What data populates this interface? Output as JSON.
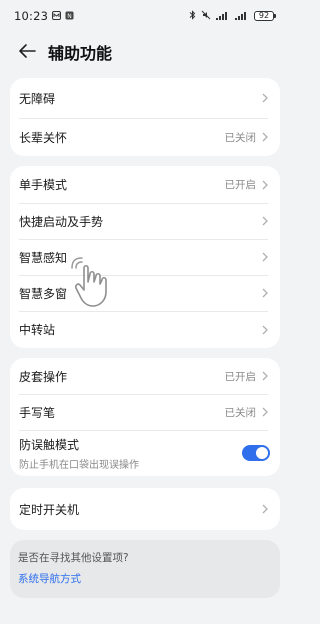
{
  "status_bar": {
    "time": "10:23",
    "battery": "92"
  },
  "header": {
    "title": "辅助功能"
  },
  "group1": [
    {
      "label": "无障碍",
      "value": ""
    },
    {
      "label": "长辈关怀",
      "value": "已关闭"
    }
  ],
  "group2": [
    {
      "label": "单手模式",
      "value": "已开启"
    },
    {
      "label": "快捷启动及手势",
      "value": ""
    },
    {
      "label": "智慧感知",
      "value": ""
    },
    {
      "label": "智慧多窗",
      "value": ""
    },
    {
      "label": "中转站",
      "value": ""
    }
  ],
  "group3": {
    "cover": {
      "label": "皮套操作",
      "value": "已开启"
    },
    "stylus": {
      "label": "手写笔",
      "value": "已关闭"
    },
    "accidental": {
      "label": "防误触模式",
      "sub": "防止手机在口袋出现误操作",
      "toggle_on": true
    }
  },
  "group4": [
    {
      "label": "定时开关机",
      "value": ""
    }
  ],
  "hint": {
    "question": "是否在寻找其他设置项?",
    "link": "系统导航方式"
  },
  "colors": {
    "accent": "#2f6fec",
    "background": "#f1f3f5"
  }
}
